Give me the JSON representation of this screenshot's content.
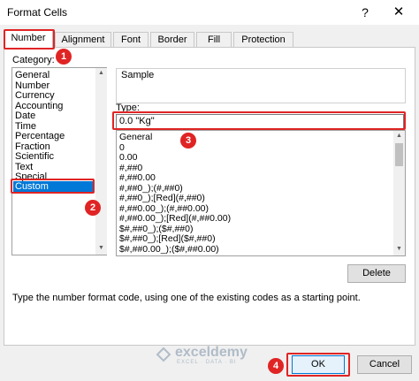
{
  "window": {
    "title": "Format Cells",
    "help_glyph": "?",
    "close_glyph": "✕"
  },
  "tabs": [
    {
      "label": "Number",
      "active": true
    },
    {
      "label": "Alignment"
    },
    {
      "label": "Font"
    },
    {
      "label": "Border"
    },
    {
      "label": "Fill"
    },
    {
      "label": "Protection"
    }
  ],
  "category": {
    "label": "Category:",
    "items": [
      "General",
      "Number",
      "Currency",
      "Accounting",
      "Date",
      "Time",
      "Percentage",
      "Fraction",
      "Scientific",
      "Text",
      "Special",
      "Custom"
    ],
    "selected": "Custom"
  },
  "sample": {
    "label": "Sample",
    "value": ""
  },
  "type": {
    "label": "Type:",
    "value": "0.0 \"Kg\""
  },
  "formats": [
    "General",
    "0",
    "0.00",
    "#,##0",
    "#,##0.00",
    "#,##0_);(#,##0)",
    "#,##0_);[Red](#,##0)",
    "#,##0.00_);(#,##0.00)",
    "#,##0.00_);[Red](#,##0.00)",
    "$#,##0_);($#,##0)",
    "$#,##0_);[Red]($#,##0)",
    "$#,##0.00_);($#,##0.00)"
  ],
  "buttons": {
    "delete": "Delete",
    "ok": "OK",
    "cancel": "Cancel"
  },
  "description": "Type the number format code, using one of the existing codes as a starting point.",
  "annotations": [
    "1",
    "2",
    "3",
    "4"
  ],
  "watermark": {
    "name": "exceldemy",
    "tagline": "EXCEL · DATA · BI"
  },
  "colors": {
    "highlight_red": "#e02424",
    "selection_blue": "#0078d7"
  }
}
